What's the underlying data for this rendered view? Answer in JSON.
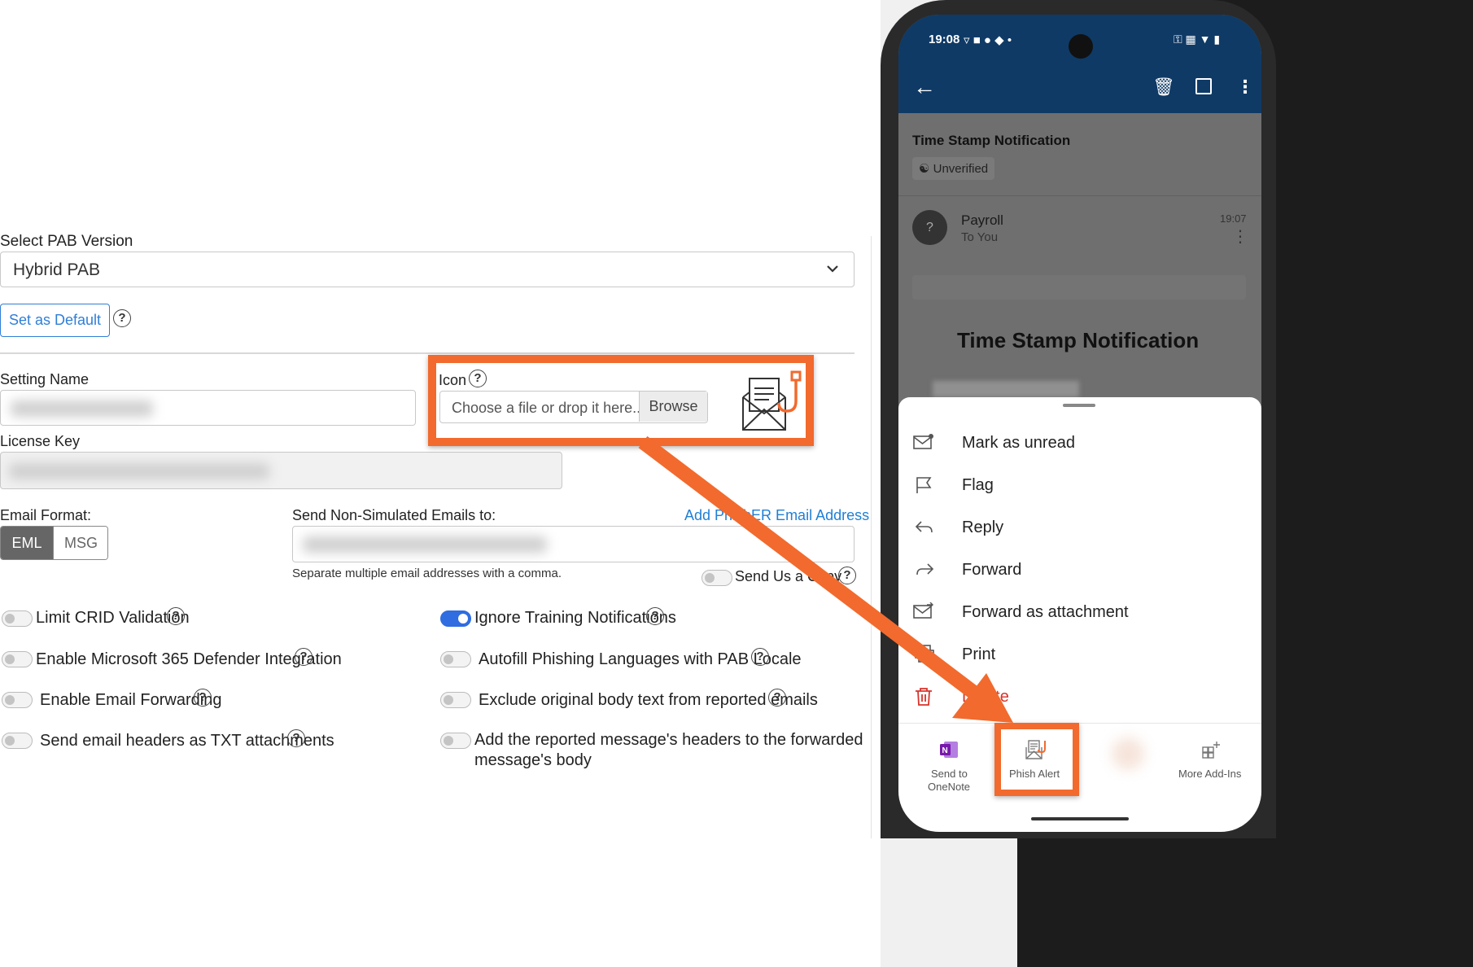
{
  "pab": {
    "select_label": "Select PAB Version",
    "select_value": "Hybrid PAB",
    "set_default": "Set as Default"
  },
  "settings": {
    "setting_name_label": "Setting Name",
    "license_key_label": "License Key",
    "icon_label": "Icon",
    "file_placeholder": "Choose a file or drop it here...",
    "browse": "Browse",
    "email_format_label": "Email Format:",
    "format_eml": "EML",
    "format_msg": "MSG",
    "send_non_sim_label": "Send Non-Simulated Emails to:",
    "add_phisher_link": "Add PhishER Email Address",
    "separate_hint": "Separate multiple email addresses with a comma.",
    "send_us_copy": "Send Us a Copy"
  },
  "options_left": [
    {
      "label": "Limit CRID Validation",
      "on": false
    },
    {
      "label": "Enable Microsoft 365 Defender Integration",
      "on": false
    },
    {
      "label": "Enable Email Forwarding",
      "on": false
    },
    {
      "label": "Send email headers as TXT attachments",
      "on": false
    }
  ],
  "options_right": [
    {
      "label": "Ignore Training Notifications",
      "on": true
    },
    {
      "label": "Autofill Phishing Languages with PAB Locale",
      "on": false
    },
    {
      "label": "Exclude original body text from reported emails",
      "on": false
    },
    {
      "label": "Add the reported message's headers to the forwarded",
      "label2": "message's body",
      "on": false
    }
  ],
  "phone": {
    "status_time": "19:08",
    "subject": "Time Stamp Notification",
    "unverified": "Unverified",
    "sender": "Payroll",
    "to": "To You",
    "sent_time": "19:07",
    "avatar": "?",
    "body_heading": "Time Stamp Notification",
    "menu": [
      {
        "label": "Mark as unread",
        "icon": "envelope-icon"
      },
      {
        "label": "Flag",
        "icon": "flag-icon"
      },
      {
        "label": "Reply",
        "icon": "reply-icon"
      },
      {
        "label": "Forward",
        "icon": "forward-icon"
      },
      {
        "label": "Forward as attachment",
        "icon": "forward-attachment-icon"
      },
      {
        "label": "Print",
        "icon": "print-icon"
      },
      {
        "label": "Delete",
        "icon": "trash-icon"
      }
    ],
    "addins": {
      "onenote_1": "Send to",
      "onenote_2": "OneNote",
      "phish_alert": "Phish Alert",
      "more_addins": "More Add-Ins"
    }
  },
  "colors": {
    "accent_blue": "#2f6de1",
    "link_blue": "#1f7fd6",
    "highlight_orange": "#f26a2d",
    "phone_header": "#0f3a66",
    "delete_red": "#d7342b"
  }
}
